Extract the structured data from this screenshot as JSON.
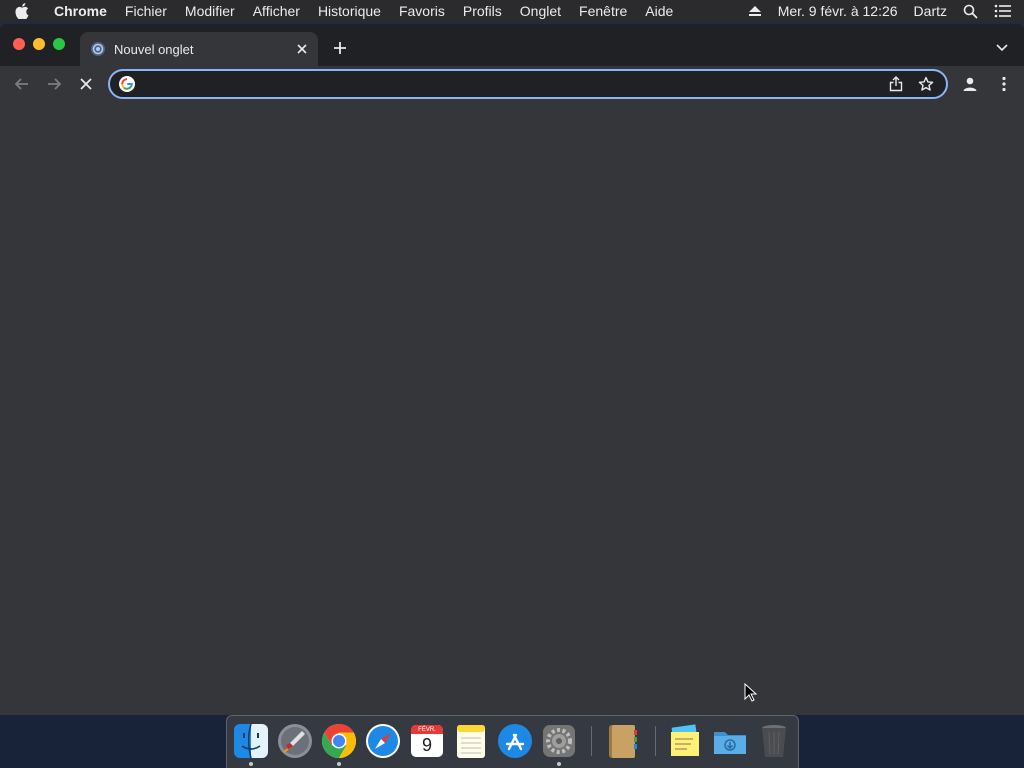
{
  "menubar": {
    "app_name": "Chrome",
    "menus": [
      "Fichier",
      "Modifier",
      "Afficher",
      "Historique",
      "Favoris",
      "Profils",
      "Onglet",
      "Fenêtre",
      "Aide"
    ],
    "clock": "Mer. 9 févr. à 12:26",
    "user": "Dartz",
    "icons": [
      "apple-icon",
      "eject-icon",
      "spotlight-search-icon",
      "notification-center-icon"
    ]
  },
  "browser": {
    "tab": {
      "title": "Nouvel onglet",
      "icon": "chrome-newtab-icon"
    },
    "omnibox": {
      "value": "",
      "placeholder": "",
      "icon": "google-g-icon"
    },
    "toolbar_icons": [
      "back-arrow-icon",
      "forward-arrow-icon",
      "stop-loading-icon",
      "share-icon",
      "bookmark-star-icon",
      "profile-icon",
      "more-menu-icon"
    ]
  },
  "dock": {
    "calendar_month": "FÉVR.",
    "calendar_day": "9",
    "apps": [
      "finder",
      "launchpad",
      "chrome",
      "safari",
      "calendar",
      "notes",
      "app-store",
      "system-preferences",
      "contacts",
      "stickies",
      "downloads-folder",
      "trash"
    ]
  },
  "colors": {
    "accent": "#8ab4f8",
    "window_bg": "#35363a",
    "tabstrip_bg": "#202124",
    "close": "#ff5f57",
    "minimize": "#febc2e",
    "maximize": "#28c840"
  }
}
